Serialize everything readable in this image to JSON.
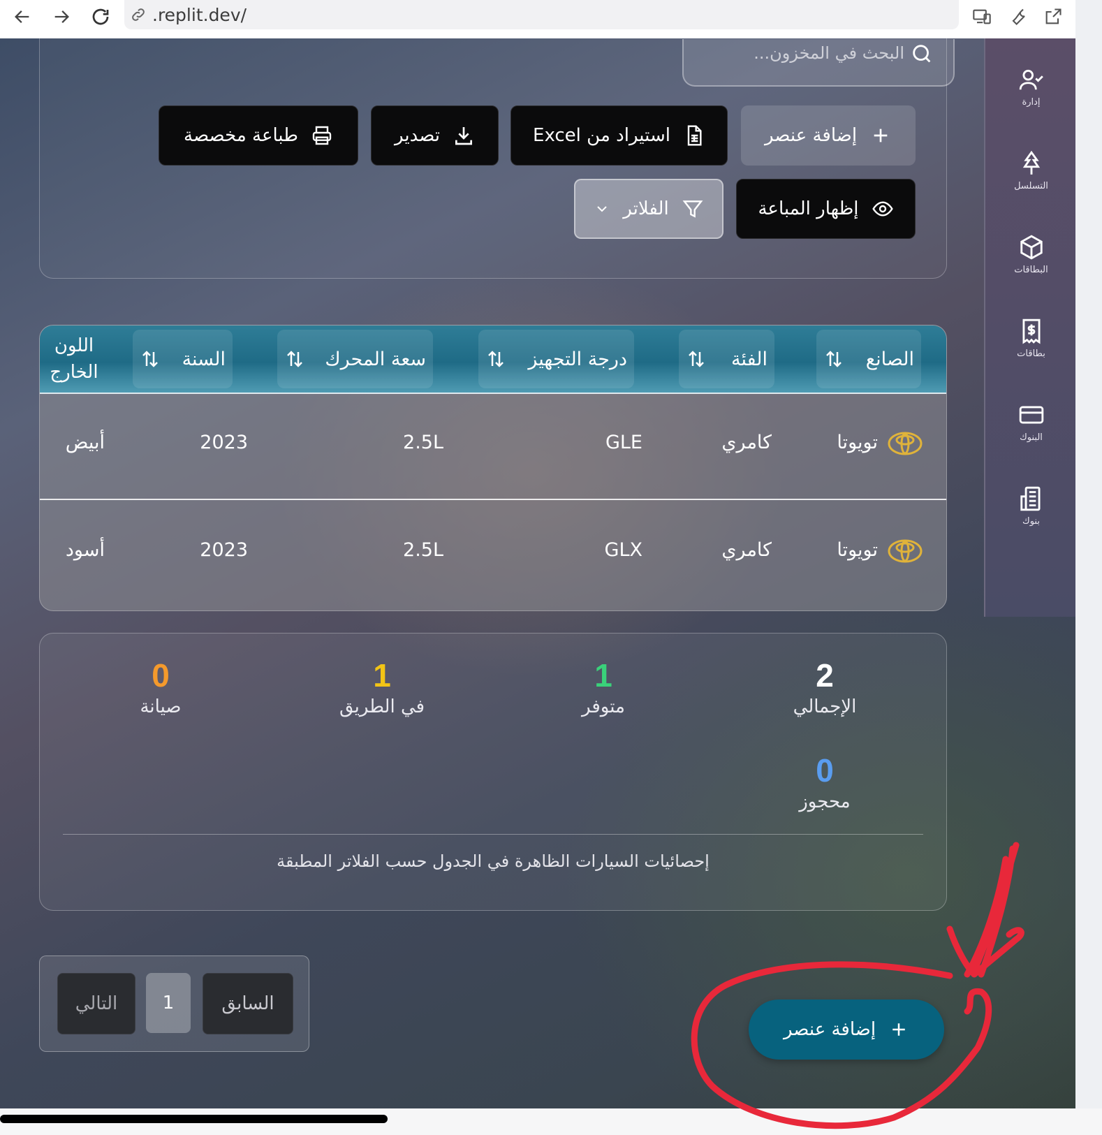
{
  "browser": {
    "url": ".replit.dev/"
  },
  "search": {
    "placeholder": "البحث في المخزون..."
  },
  "toolbar": {
    "add_item": "إضافة عنصر",
    "import_excel": "استيراد من Excel",
    "export": "تصدير",
    "custom_print": "طباعة مخصصة",
    "show_sold": "إظهار المباعة",
    "filters": "الفلاتر"
  },
  "sidebar": {
    "items": [
      {
        "label": "إدارة",
        "icon": "user-check-icon"
      },
      {
        "label": "التسلسل",
        "icon": "tree-icon"
      },
      {
        "label": "البطاقات",
        "icon": "box-icon"
      },
      {
        "label": "بطاقات",
        "icon": "receipt-dollar-icon"
      },
      {
        "label": "البنوك",
        "icon": "credit-card-icon"
      },
      {
        "label": "بنوك",
        "icon": "bank-building-icon"
      }
    ]
  },
  "table": {
    "headers": [
      "الصانع",
      "الفئة",
      "درجة التجهيز",
      "سعة المحرك",
      "السنة",
      "اللون الخارج"
    ],
    "rows": [
      {
        "maker": "تويوتا",
        "category": "كامري",
        "trim": "GLE",
        "engine": "2.5L",
        "year": "2023",
        "color": "أبيض"
      },
      {
        "maker": "تويوتا",
        "category": "كامري",
        "trim": "GLX",
        "engine": "2.5L",
        "year": "2023",
        "color": "أسود"
      }
    ]
  },
  "stats": {
    "total": {
      "value": "2",
      "label": "الإجمالي",
      "color": "#ffffff"
    },
    "available": {
      "value": "1",
      "label": "متوفر",
      "color": "#3ad17a"
    },
    "on_the_way": {
      "value": "1",
      "label": "في الطريق",
      "color": "#f2c416"
    },
    "maintenance": {
      "value": "0",
      "label": "صيانة",
      "color": "#f59a2c"
    },
    "reserved": {
      "value": "0",
      "label": "محجوز",
      "color": "#5a9df0"
    },
    "note": "إحصائيات السيارات الظاهرة في الجدول حسب الفلاتر المطبقة"
  },
  "pagination": {
    "prev": "السابق",
    "page": "1",
    "next": "التالي"
  },
  "fab": {
    "label": "إضافة عنصر"
  },
  "colors": {
    "fab": "#07627e",
    "table_header": "#1f6b86",
    "toyota_logo": "#e0b33a",
    "annotation": "#e8283a"
  }
}
